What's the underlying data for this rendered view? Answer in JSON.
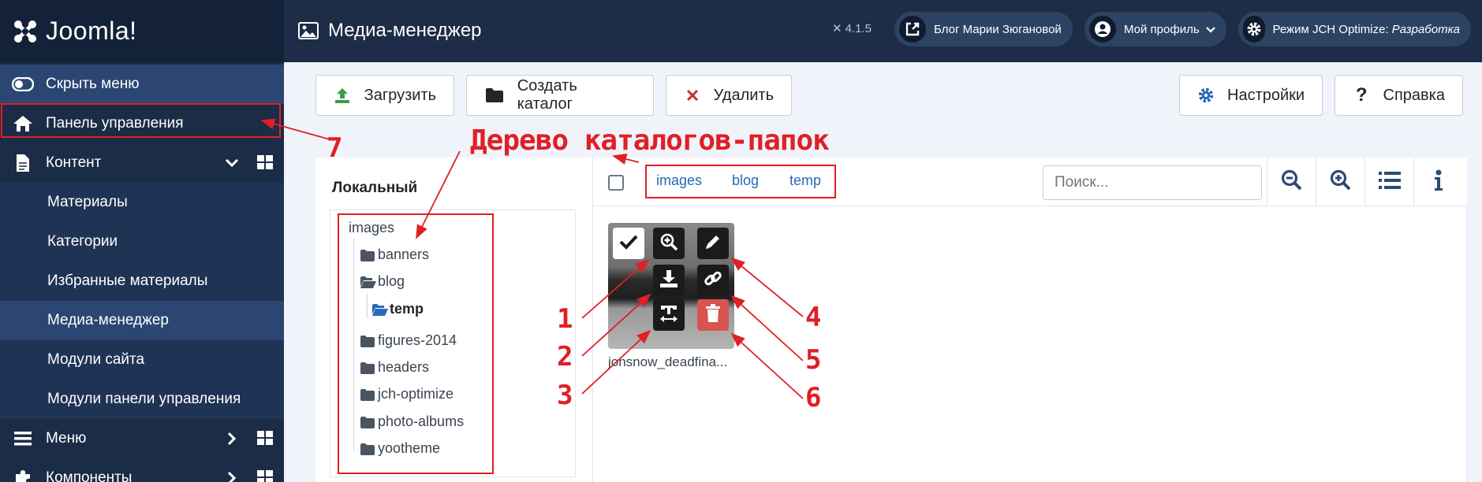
{
  "header": {
    "logo_text": "Joomla!",
    "page_title": "Медиа-менеджер",
    "version": "4.1.5",
    "site_link": "Блог Марии Зюгановой",
    "profile": "Мой профиль",
    "jch_mode_label": "Режим JCH Optimize:",
    "jch_mode_value": "Разработка"
  },
  "sidebar": {
    "toggle_label": "Скрыть меню",
    "items": [
      {
        "label": "Панель управления"
      },
      {
        "label": "Контент"
      },
      {
        "label": "Материалы"
      },
      {
        "label": "Категории"
      },
      {
        "label": "Избранные материалы"
      },
      {
        "label": "Медиа-менеджер"
      },
      {
        "label": "Модули сайта"
      },
      {
        "label": "Модули панели управления"
      },
      {
        "label": "Меню"
      },
      {
        "label": "Компоненты"
      }
    ]
  },
  "toolbar": {
    "upload": "Загрузить",
    "create_folder": "Создать каталог",
    "delete": "Удалить",
    "options": "Настройки",
    "help": "Справка"
  },
  "tree": {
    "title": "Локальный",
    "root": "images",
    "nodes": [
      "banners",
      "blog",
      "temp",
      "figures-2014",
      "headers",
      "jch-optimize",
      "photo-albums",
      "yootheme"
    ]
  },
  "breadcrumbs": [
    "images",
    "blog",
    "temp"
  ],
  "search": {
    "placeholder": "Поиск..."
  },
  "file": {
    "name": "jonsnow_deadfina..."
  },
  "annotations": {
    "title": "Дерево каталогов-папок",
    "n1": "1",
    "n2": "2",
    "n3": "3",
    "n4": "4",
    "n5": "5",
    "n6": "6",
    "n7": "7"
  },
  "colors": {
    "header_bg": "#1d2d47",
    "sidebar_bg": "#1b2c47",
    "accent_red": "#e01f26",
    "link_blue": "#2a69b8",
    "delete_red": "#d9534f"
  }
}
